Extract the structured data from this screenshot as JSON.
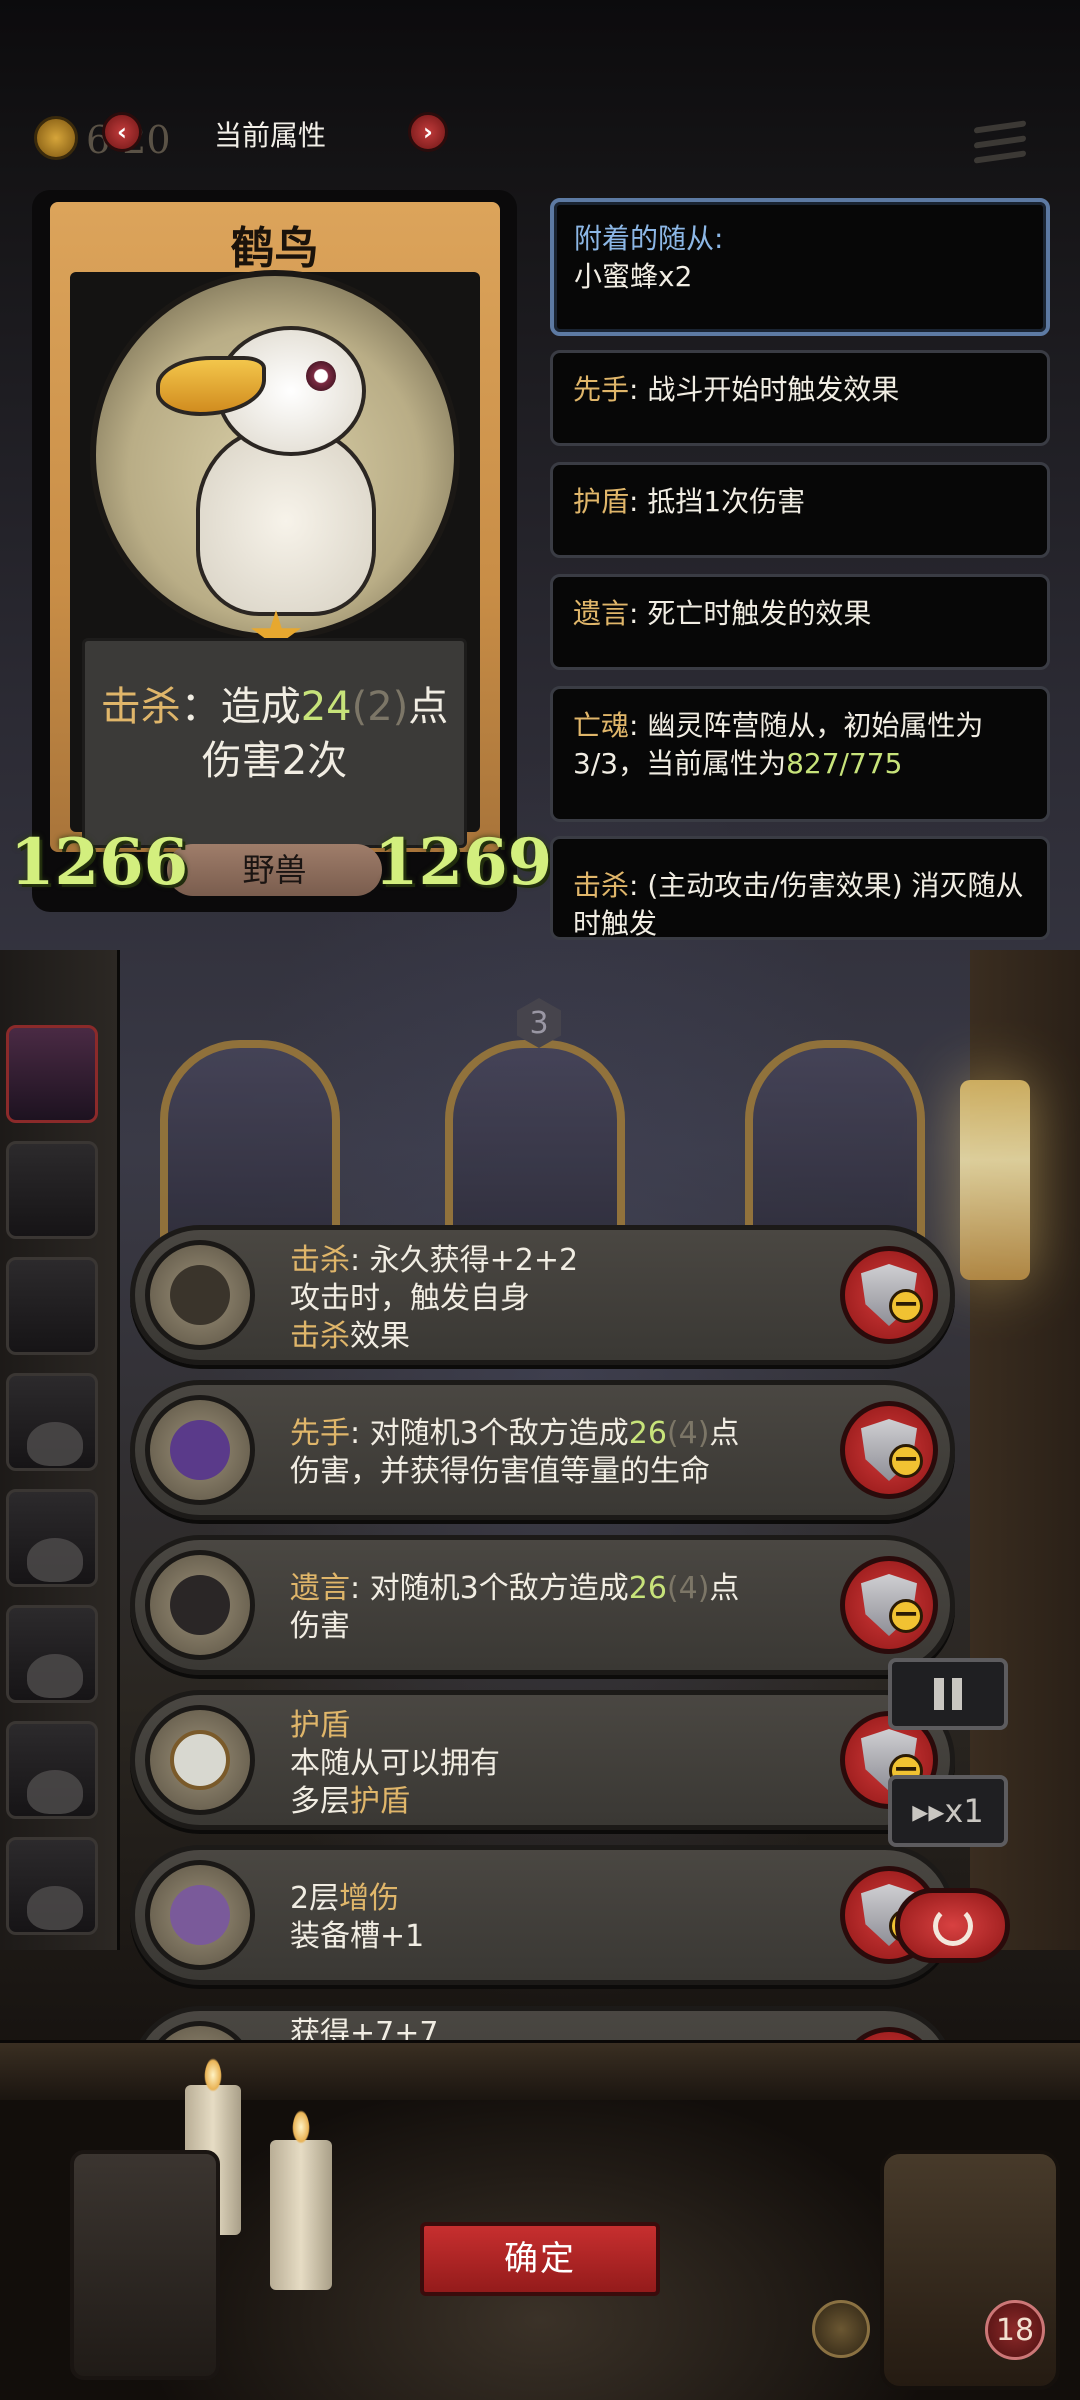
{
  "topbar": {
    "coin_value": "6 20",
    "title": "当前属性"
  },
  "hero": {
    "name": "鹤鸟",
    "desc_kw": "击杀",
    "desc_sep": "：",
    "desc_a": "造成",
    "desc_num": "24",
    "desc_num_bonus": "(2)",
    "desc_b": "点",
    "desc_line2": "伤害2次",
    "tribe": "野兽",
    "attack": "1266",
    "health": "1269"
  },
  "panels": {
    "attached_title": "附着的随从:",
    "attached_value": "小蜜蜂x2",
    "first_kw": "先手",
    "first_text": ": 战斗开始时触发效果",
    "shield_kw": "护盾",
    "shield_text": ": 抵挡1次伤害",
    "deathrattle_kw": "遗言",
    "deathrattle_text": ": 死亡时触发的效果",
    "ghost_kw": "亡魂",
    "ghost_text": ": 幽灵阵营随从，初始属性为3/3，当前属性为",
    "ghost_stat": "827/775",
    "kill_kw": "击杀",
    "kill_text": ": (主动攻击/伤害效果) 消灭随从时触发"
  },
  "board": {
    "badge": "3"
  },
  "enchantments": [
    {
      "line1_kw": "击杀",
      "line1": ": 永久获得+2+2",
      "line2": "攻击时，触发自身",
      "line3_kw": "击杀",
      "line3": "效果"
    },
    {
      "kw": "先手",
      "a": ": 对随机3个敌方造成",
      "num": "26",
      "bonus": "(4)",
      "b": "点",
      "line2": "伤害，并获得伤害值等量的生命"
    },
    {
      "kw": "遗言",
      "a": ": 对随机3个敌方造成",
      "num": "26",
      "bonus": "(4)",
      "b": "点",
      "line2": "伤害"
    },
    {
      "title_kw": "护盾",
      "line2": "本随从可以拥有",
      "line3_a": "多层",
      "line3_kw": "护盾"
    },
    {
      "line1_a": "2层",
      "line1_kw": "增伤",
      "line2": "装备槽+1"
    },
    {
      "line1": "获得+7+7"
    }
  ],
  "controls": {
    "speed": "x1"
  },
  "footer": {
    "confirm": "确定",
    "hearts": "18"
  },
  "colors": {
    "keyword": "#e0b66a",
    "green_stat": "#d3ef7e",
    "confirm_red": "#c72f2f",
    "attached_border": "#5d7aa3"
  }
}
